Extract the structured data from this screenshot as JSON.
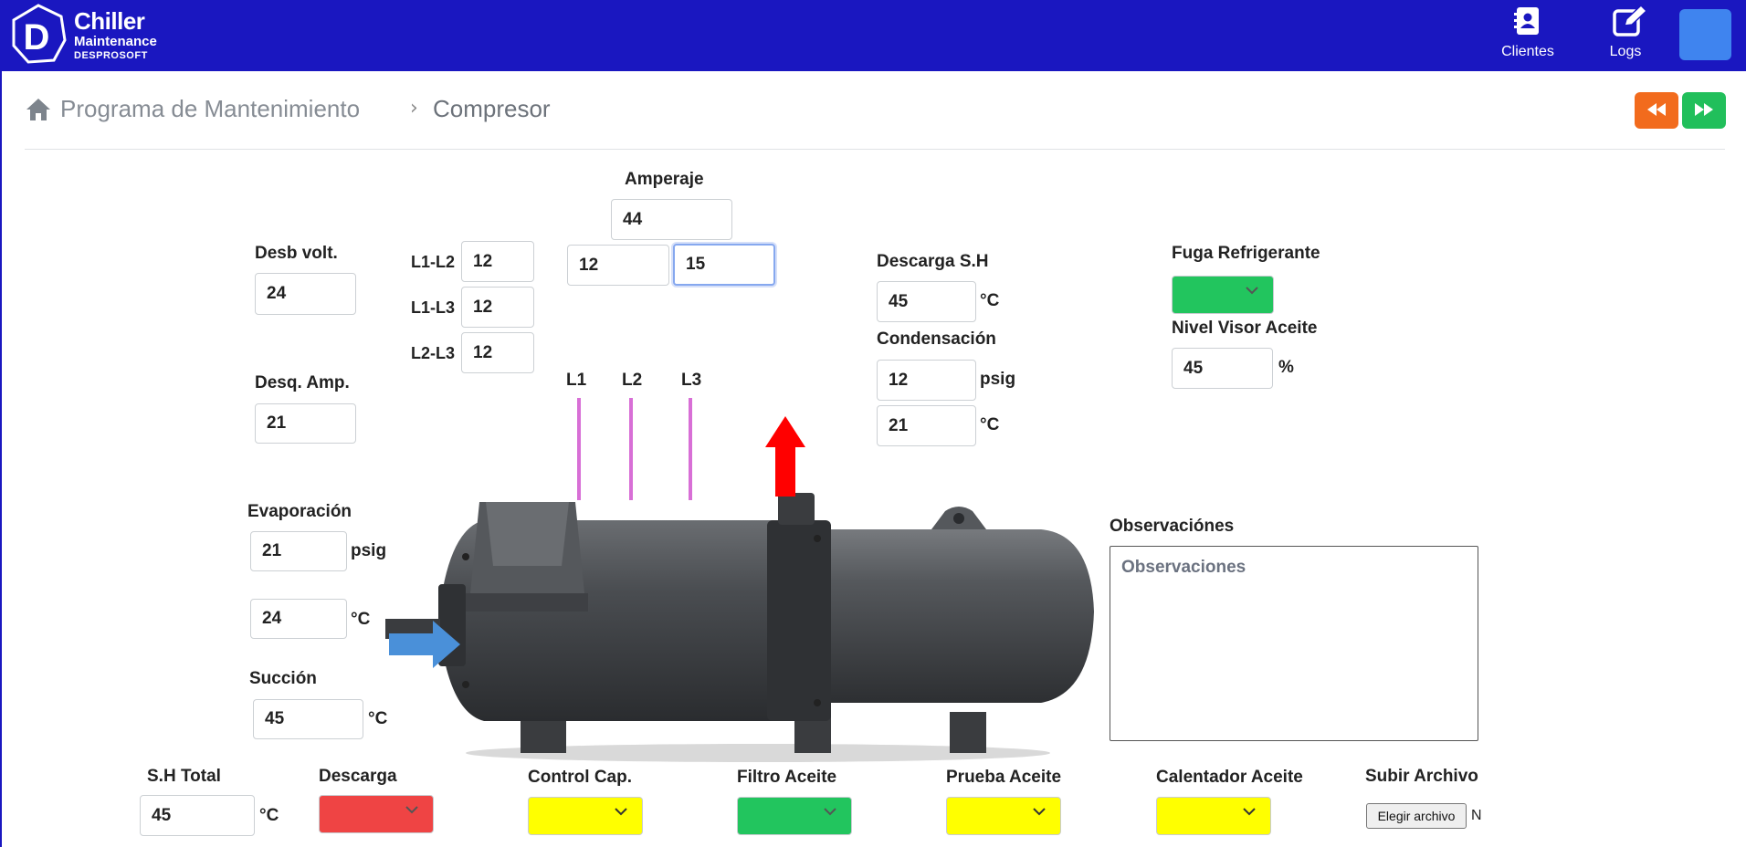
{
  "brand": {
    "line1": "Chiller",
    "line2": "Maintenance",
    "line3": "DESPROSOFT",
    "initial": "D"
  },
  "nav": {
    "clientes": "Clientes",
    "logs": "Logs"
  },
  "breadcrumb": {
    "parent": "Programa de Mantenimiento",
    "separator": "›",
    "current": "Compresor"
  },
  "colors": {
    "header": "#1a17c0",
    "prev": "#f26b1d",
    "next": "#21bf5b",
    "green": "#22c55e",
    "red": "#ef4444",
    "yellow": "#ffff00",
    "wire": "#d86fd6",
    "arrow_in": "#4a90d9",
    "arrow_out": "#ff0000"
  },
  "form": {
    "amperaje": {
      "label": "Amperaje",
      "value": "44",
      "l1": "12",
      "l2": "15"
    },
    "desb_volt": {
      "label": "Desb volt.",
      "value": "24"
    },
    "l1_l2": {
      "label": "L1-L2",
      "value": "12"
    },
    "l1_l3": {
      "label": "L1-L3",
      "value": "12"
    },
    "l2_l3": {
      "label": "L2-L3",
      "value": "12"
    },
    "desq_amp": {
      "label": "Desq. Amp.",
      "value": "21"
    },
    "phases": {
      "l1": "L1",
      "l2": "L2",
      "l3": "L3"
    },
    "descarga_sh": {
      "label": "Descarga S.H",
      "value": "45",
      "unit": "°C"
    },
    "condensacion": {
      "label": "Condensación",
      "psig": "12",
      "psig_unit": "psig",
      "temp": "21",
      "temp_unit": "°C"
    },
    "fuga_refrigerante": {
      "label": "Fuga Refrigerante",
      "status": "green"
    },
    "nivel_visor_aceite": {
      "label": "Nivel Visor Aceite",
      "value": "45",
      "unit": "%"
    },
    "evaporacion": {
      "label": "Evaporación",
      "psig": "21",
      "psig_unit": "psig",
      "temp": "24",
      "temp_unit": "°C"
    },
    "succion": {
      "label": "Succión",
      "value": "45",
      "unit": "°C"
    },
    "observaciones": {
      "label": "Observaciónes",
      "placeholder": "Observaciones"
    },
    "sh_total": {
      "label": "S.H Total",
      "value": "45",
      "unit": "°C"
    },
    "descarga": {
      "label": "Descarga",
      "status": "red"
    },
    "control_cap": {
      "label": "Control Cap.",
      "status": "yellow"
    },
    "filtro_aceite": {
      "label": "Filtro Aceite",
      "status": "green"
    },
    "prueba_aceite": {
      "label": "Prueba Aceite",
      "status": "yellow"
    },
    "calentador_aceite": {
      "label": "Calentador Aceite",
      "status": "yellow"
    },
    "subir_archivo": {
      "label": "Subir Archivo",
      "button": "Elegir archivo",
      "status_text": "N"
    }
  }
}
